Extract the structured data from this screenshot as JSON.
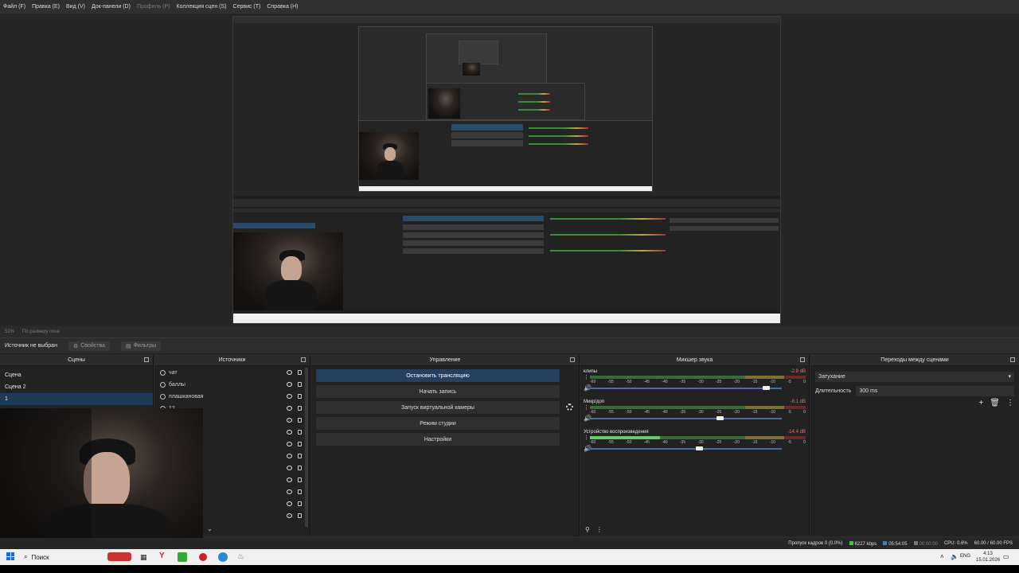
{
  "menu": [
    "Файл (F)",
    "Правка (E)",
    "Вид (V)",
    "Док-панели (D)",
    "Профиль (P)",
    "Коллекция сцен (S)",
    "Сервис (T)",
    "Справка (H)"
  ],
  "menu_disabled_index": 4,
  "scale": {
    "percent": "52%",
    "mode": "По размеру окна"
  },
  "source_bar": {
    "label": "Источник не выбран",
    "properties": "Свойства",
    "filters": "Фильтры"
  },
  "docks": {
    "scenes": {
      "title": "Сцены",
      "items": [
        "Сцена",
        "Сцена 2",
        "1"
      ],
      "selected": 2
    },
    "sources": {
      "title": "Источники",
      "items": [
        "чат",
        "баллы",
        "плашкановая",
        "12",
        "",
        "",
        "",
        "",
        "",
        "",
        "",
        "",
        ""
      ]
    },
    "controls": {
      "title": "Управление",
      "buttons": [
        "Остановить трансляцию",
        "Начать запись",
        "Запуск виртуальной камеры",
        "Режим студии",
        "Настройки"
      ]
    },
    "mixer": {
      "title": "Микшер звука",
      "channels": [
        {
          "name": "клипы",
          "db": "-2.9 dB",
          "level": 0.0,
          "volume": 0.92
        },
        {
          "name": "Микр/доп",
          "db": "-8.1 dB",
          "level": 0.0,
          "volume": 0.68
        },
        {
          "name": "Устройство воспроизведения",
          "db": "-14.4 dB",
          "level": 0.35,
          "volume": 0.57
        }
      ],
      "ticks": [
        "-60",
        "-55",
        "-50",
        "-45",
        "-40",
        "-35",
        "-30",
        "-25",
        "-20",
        "-15",
        "-10",
        "-5",
        "0"
      ]
    },
    "transitions": {
      "title": "Переходы между сценами",
      "type": "Затухание",
      "duration_label": "Длительность",
      "duration_value": "300 ms"
    }
  },
  "status": {
    "dropped": "Пропуск кадров 0 (0.0%)",
    "bitrate": "6227 kbps",
    "live_time": "05:54:05",
    "rec_time": "00:00:00",
    "cpu": "CPU: 0.6%",
    "fps": "60.00 / 60.00 FPS"
  },
  "taskbar": {
    "search": "Поиск",
    "lang": "ENG",
    "time": "4:13",
    "date": "15.01.2026"
  },
  "colors": {
    "accent": "#24405e",
    "meter_green": "#5fd05f",
    "selection": "#1c3a56"
  }
}
